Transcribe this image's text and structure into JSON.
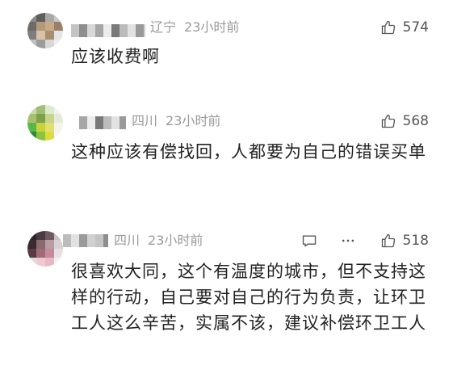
{
  "comments": [
    {
      "location": "辽宁",
      "time": "23小时前",
      "likes": "574",
      "text": "应该收费啊",
      "avatar_colors": [
        "#8a8a8a",
        "#5e5e5e",
        "#a8a8a8",
        "#c8c8c8",
        "#6f6a66",
        "#b59a7a",
        "#c9a98a",
        "#9a8068",
        "#7d7d7d",
        "#d6c2a8",
        "#a88e6c",
        "#e4e4e4",
        "#bfbfbf",
        "#9c9c9c",
        "#d7d7d7",
        "#ededed"
      ],
      "show_extra": false
    },
    {
      "location": "四川",
      "time": "23小时前",
      "likes": "568",
      "text": "这种应该有偿找回，人都要为自己的错误买单",
      "avatar_colors": [
        "#c8d8a8",
        "#9fbf78",
        "#dfe8d2",
        "#f1f1f1",
        "#a7c070",
        "#7fa04a",
        "#c8d48c",
        "#e5ead8",
        "#56b848",
        "#c8d23c",
        "#e2e06a",
        "#f4f4e8",
        "#2c8a3a",
        "#8cc23c",
        "#dedc3c",
        "#f6f6f6"
      ],
      "show_extra": false
    },
    {
      "location": "四川",
      "time": "23小时前",
      "likes": "518",
      "text": "很喜欢大同，这个有温度的城市，但不支持这样的行动，自己要对自己的行为负责，让环卫工人这么辛苦，实属不该，建议补偿环卫工人",
      "avatar_colors": [
        "#2a2230",
        "#4a3a44",
        "#6e5a60",
        "#c8c0c4",
        "#3a2a34",
        "#8a6a70",
        "#b89aa0",
        "#d8d0d4",
        "#5a3a44",
        "#a26a78",
        "#c88a98",
        "#e8e0e4",
        "#e0dcdc",
        "#f0c8d0",
        "#e8b8c4",
        "#f4f0f2"
      ],
      "show_extra": true
    }
  ],
  "icons": {
    "like": "thumbs-up-icon",
    "reply": "comment-icon",
    "more": "more-icon"
  }
}
